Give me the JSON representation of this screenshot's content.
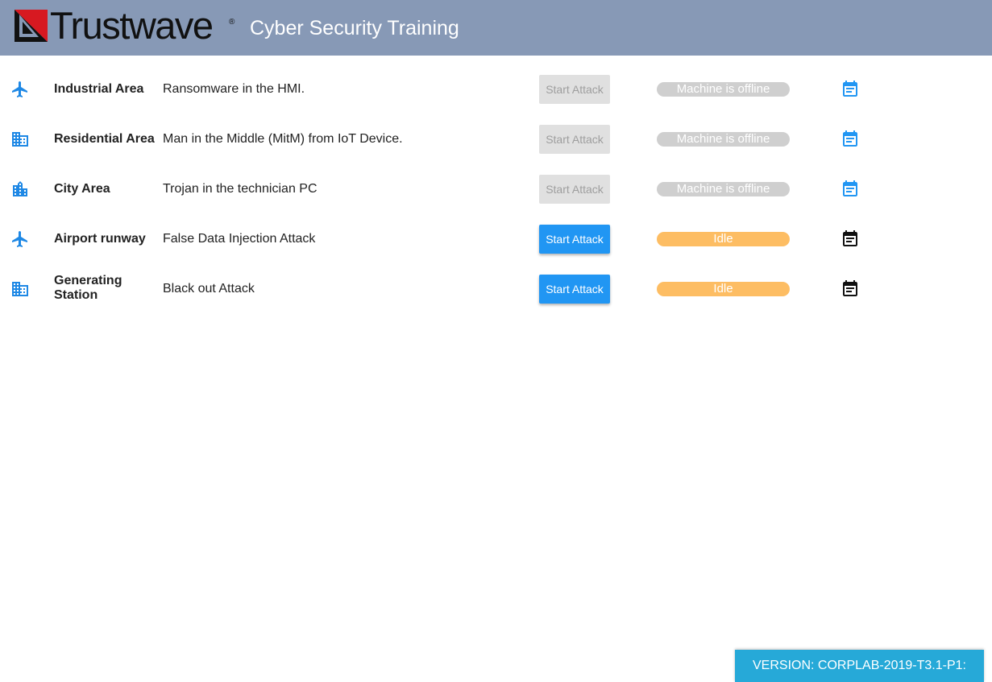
{
  "header": {
    "brand": "Trustwave",
    "registered_mark": "®",
    "title": "Cyber Security Training",
    "background_color": "#8799b6",
    "logo_colors": [
      "#d71921",
      "#111111"
    ]
  },
  "scenarios": [
    {
      "icon": "airplane-icon",
      "area": "Industrial Area",
      "description": "Ransomware in the HMI.",
      "button_label": "Start Attack",
      "button_enabled": false,
      "status": "Machine is offline",
      "status_kind": "offline",
      "calendar_icon": "calendar-icon",
      "calendar_color": "#2196f3"
    },
    {
      "icon": "building-icon",
      "area": "Residential Area",
      "description": "Man in the Middle (MitM) from IoT Device.",
      "button_label": "Start Attack",
      "button_enabled": false,
      "status": "Machine is offline",
      "status_kind": "offline",
      "calendar_icon": "calendar-icon",
      "calendar_color": "#2196f3"
    },
    {
      "icon": "city-icon",
      "area": "City Area",
      "description": "Trojan in the technician PC",
      "button_label": "Start Attack",
      "button_enabled": false,
      "status": "Machine is offline",
      "status_kind": "offline",
      "calendar_icon": "calendar-icon",
      "calendar_color": "#2196f3"
    },
    {
      "icon": "airplane-icon",
      "area": "Airport runway",
      "description": "False Data Injection Attack",
      "button_label": "Start Attack",
      "button_enabled": true,
      "status": "Idle",
      "status_kind": "idle",
      "calendar_icon": "calendar-icon",
      "calendar_color": "#111111"
    },
    {
      "icon": "building-icon",
      "area": "Generating Station",
      "description": "Black out Attack",
      "button_label": "Start Attack",
      "button_enabled": true,
      "status": "Idle",
      "status_kind": "idle",
      "calendar_icon": "calendar-icon",
      "calendar_color": "#111111"
    }
  ],
  "footer": {
    "version": "VERSION: CORPLAB-2019-T3.1-P1:",
    "background_color": "#26a9d8"
  },
  "colors": {
    "accent_blue": "#2196f3",
    "row_icon_blue": "#1e88e5",
    "idle_orange": "#fdbd63",
    "offline_gray": "#cfcfcf",
    "disabled_button": "#e0e0e0"
  }
}
